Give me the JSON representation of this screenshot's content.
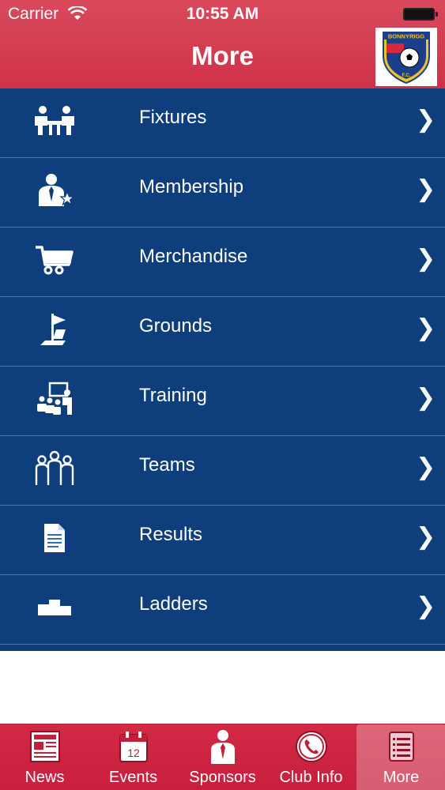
{
  "status_bar": {
    "carrier": "Carrier",
    "time": "10:55 AM"
  },
  "header": {
    "title": "More",
    "logo_text": "BONNYRIGG",
    "logo_sub": "F.C."
  },
  "menu": {
    "items": [
      {
        "label": "Fixtures",
        "icon": "fixtures-icon",
        "chevron": "❯"
      },
      {
        "label": "Membership",
        "icon": "membership-icon",
        "chevron": "❯"
      },
      {
        "label": "Merchandise",
        "icon": "shopping-cart-icon",
        "chevron": "❯"
      },
      {
        "label": "Grounds",
        "icon": "flag-icon",
        "chevron": "❯"
      },
      {
        "label": "Training",
        "icon": "training-icon",
        "chevron": "❯"
      },
      {
        "label": "Teams",
        "icon": "teams-icon",
        "chevron": "❯"
      },
      {
        "label": "Results",
        "icon": "document-icon",
        "chevron": "❯"
      },
      {
        "label": "Ladders",
        "icon": "podium-icon",
        "chevron": "❯"
      }
    ]
  },
  "tabs": [
    {
      "label": "News",
      "icon": "newspaper-icon"
    },
    {
      "label": "Events",
      "icon": "calendar-icon",
      "badge": "12"
    },
    {
      "label": "Sponsors",
      "icon": "businessman-icon"
    },
    {
      "label": "Club Info",
      "icon": "phone-icon"
    },
    {
      "label": "More",
      "icon": "list-icon",
      "selected": true
    }
  ],
  "colors": {
    "header": "#d43a50",
    "menu_bg": "#0e3e7b",
    "separator": "#b64a67",
    "tab_bar": "#cd253f"
  }
}
